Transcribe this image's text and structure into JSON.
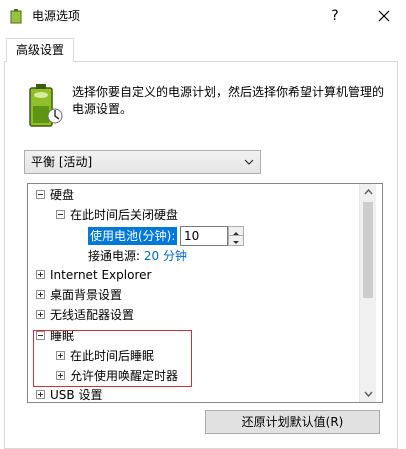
{
  "window": {
    "title": "电源选项",
    "help_label": "?"
  },
  "tab": {
    "label": "高级设置"
  },
  "description": "选择你要自定义的电源计划，然后选择你希望计算机管理的电源设置。",
  "plan": {
    "selected": "平衡 [活动]"
  },
  "tree": {
    "hard_disk": "硬盘",
    "turn_off_after": "在此时间后关闭硬盘",
    "on_battery_label": "使用电池(分钟):",
    "on_battery_value": "10",
    "plugged_in_label": "接通电源:",
    "plugged_in_value": "20 分钟",
    "internet_explorer": "Internet Explorer",
    "desktop_background": "桌面背景设置",
    "wireless_adapter": "无线适配器设置",
    "sleep": "睡眠",
    "sleep_after": "在此时间后睡眠",
    "allow_wake_timers": "允许使用唤醒定时器",
    "usb": "USB 设置"
  },
  "buttons": {
    "restore_defaults": "还原计划默认值(R)"
  },
  "colors": {
    "selection": "#0078d7",
    "link": "#0066cc",
    "highlight_border": "#c8323c"
  },
  "icons": [
    "power-options-icon",
    "close-icon",
    "battery-plan-icon",
    "chevron-down-icon",
    "scroll-up-icon",
    "scroll-down-icon",
    "spin-up-icon",
    "spin-down-icon"
  ]
}
